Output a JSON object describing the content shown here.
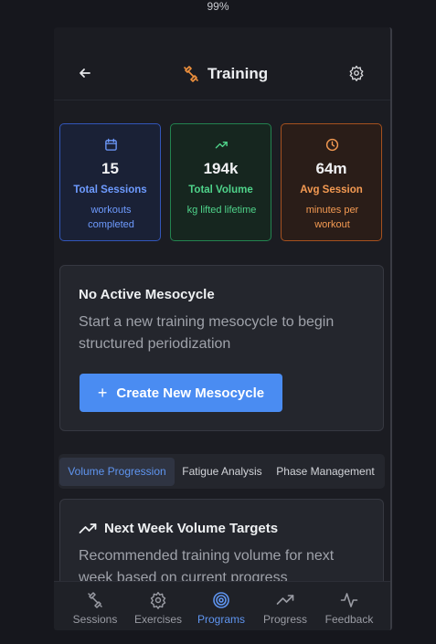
{
  "zoom": "99%",
  "header": {
    "title": "Training"
  },
  "stats": [
    {
      "icon": "calendar-icon",
      "value": "15",
      "label": "Total Sessions",
      "sub": "workouts completed"
    },
    {
      "icon": "trending-up-icon",
      "value": "194k",
      "label": "Total Volume",
      "sub": "kg lifted lifetime"
    },
    {
      "icon": "clock-icon",
      "value": "64m",
      "label": "Avg Session",
      "sub": "minutes per workout"
    }
  ],
  "mesocycle": {
    "title": "No Active Mesocycle",
    "description": "Start a new training mesocycle to begin structured periodization",
    "button_label": "Create New Mesocycle"
  },
  "tabs": [
    {
      "label": "Volume Progression",
      "active": true
    },
    {
      "label": "Fatigue Analysis",
      "active": false
    },
    {
      "label": "Phase Management",
      "active": false
    }
  ],
  "targets": {
    "title": "Next Week Volume Targets",
    "description": "Recommended training volume for next week based on current progress"
  },
  "nav": [
    {
      "icon": "dumbbell-icon",
      "label": "Sessions",
      "active": false
    },
    {
      "icon": "gear-icon",
      "label": "Exercises",
      "active": false
    },
    {
      "icon": "target-icon",
      "label": "Programs",
      "active": true
    },
    {
      "icon": "trending-up-icon",
      "label": "Progress",
      "active": false
    },
    {
      "icon": "activity-icon",
      "label": "Feedback",
      "active": false
    }
  ],
  "colors": {
    "accent": "#4a8cf2",
    "blue": "#6e9bff",
    "green": "#4fd38a",
    "orange": "#f49a52"
  }
}
